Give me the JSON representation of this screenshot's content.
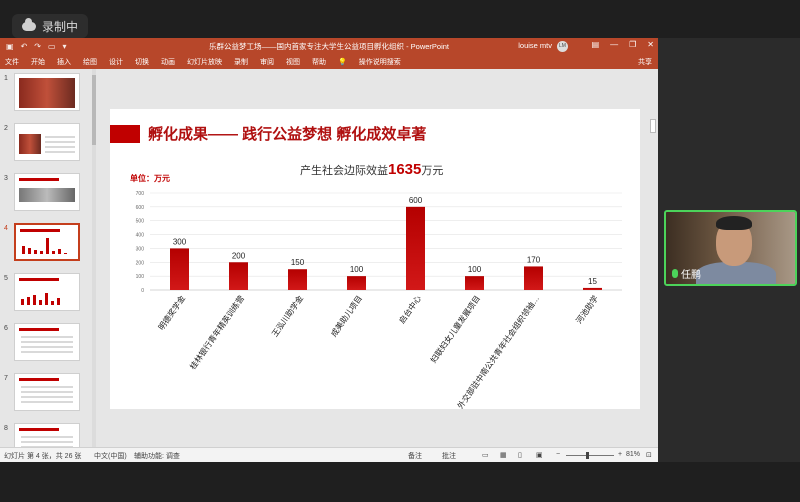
{
  "recording": {
    "label": "录制中"
  },
  "window": {
    "title": "乐群公益梦工场——国内首家专注大学生公益项目孵化组织 - PowerPoint",
    "user": "louise mtv",
    "avatar_initials": "LM"
  },
  "ribbon": {
    "tabs": [
      "文件",
      "开始",
      "插入",
      "绘图",
      "设计",
      "切换",
      "动画",
      "幻灯片放映",
      "录制",
      "审阅",
      "视图",
      "帮助"
    ],
    "search": "操作说明搜索",
    "share": "共享"
  },
  "thumbnails": [
    "1",
    "2",
    "3",
    "4",
    "5",
    "6",
    "7",
    "8"
  ],
  "active_slide": 4,
  "slide": {
    "title": "孵化成果—— 践行公益梦想 孵化成效卓著",
    "chart_heading_prefix": "产生社会边际效益",
    "chart_heading_value": "1635",
    "chart_heading_suffix": "万元",
    "unit": "单位：万元"
  },
  "chart_data": {
    "type": "bar",
    "categories": [
      "明德奖学金",
      "桂林银行青年精英训练营",
      "王泓川助学金",
      "成美助儿项目",
      "启台中心",
      "妇联妇女儿童发展项目",
      "外交部驻中南公共青年社会组织领袖…",
      "河池助学"
    ],
    "values": [
      300,
      200,
      150,
      100,
      600,
      100,
      170,
      15
    ],
    "ylim": [
      0,
      700
    ],
    "yticks": [
      0,
      100,
      200,
      300,
      400,
      500,
      600,
      700
    ],
    "grid": true,
    "color": "#c00000"
  },
  "statusbar": {
    "slide_info": "幻灯片 第 4 张，共 26 张",
    "language": "中文(中国)",
    "accessibility": "辅助功能: 调查",
    "notes": "备注",
    "comments": "批注",
    "zoom": "81%"
  },
  "webcam": {
    "name": "任鹏"
  }
}
